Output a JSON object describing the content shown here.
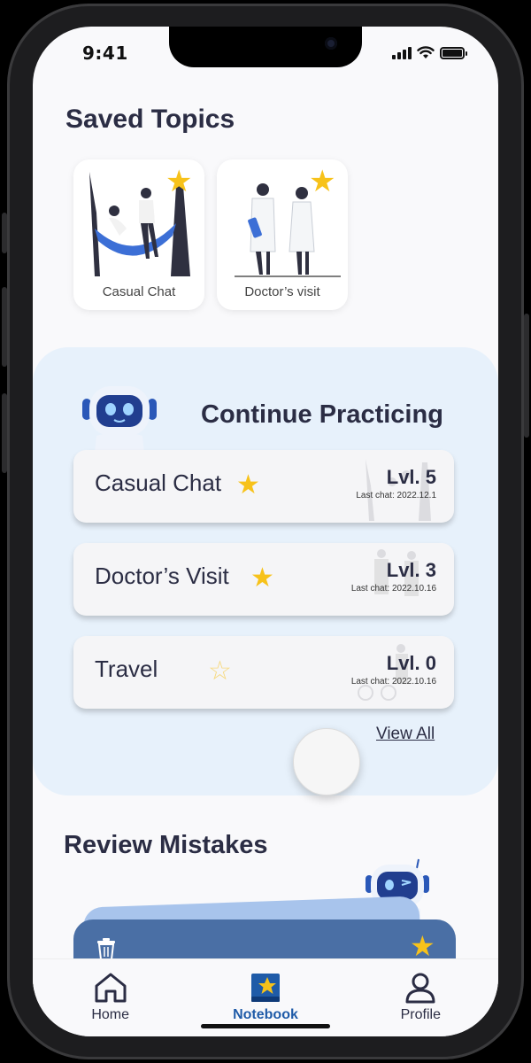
{
  "status_bar": {
    "time": "9:41"
  },
  "saved_topics": {
    "title": "Saved Topics",
    "items": [
      {
        "label": "Casual Chat",
        "starred": true
      },
      {
        "label": "Doctor’s visit",
        "starred": true
      }
    ]
  },
  "continue_practicing": {
    "title": "Continue Practicing",
    "items": [
      {
        "name": "Casual Chat",
        "level": "Lvl. 5",
        "last_chat": "Last chat: 2022.12.1",
        "starred": true
      },
      {
        "name": "Doctor’s Visit",
        "level": "Lvl. 3",
        "last_chat": "Last chat: 2022.10.16",
        "starred": true
      },
      {
        "name": "Travel",
        "level": "Lvl. 0",
        "last_chat": "Last chat: 2022.10.16",
        "starred": false
      }
    ],
    "view_all": "View All"
  },
  "review_mistakes": {
    "title": "Review Mistakes"
  },
  "tabbar": {
    "items": [
      {
        "label": "Home",
        "icon": "home-icon"
      },
      {
        "label": "Notebook",
        "icon": "notebook-icon",
        "active": true
      },
      {
        "label": "Profile",
        "icon": "profile-icon"
      }
    ]
  },
  "colors": {
    "accent": "#1f5ba8",
    "star": "#f7c21a",
    "practice_bg": "#e7f1fb",
    "text": "#2b2d44"
  }
}
